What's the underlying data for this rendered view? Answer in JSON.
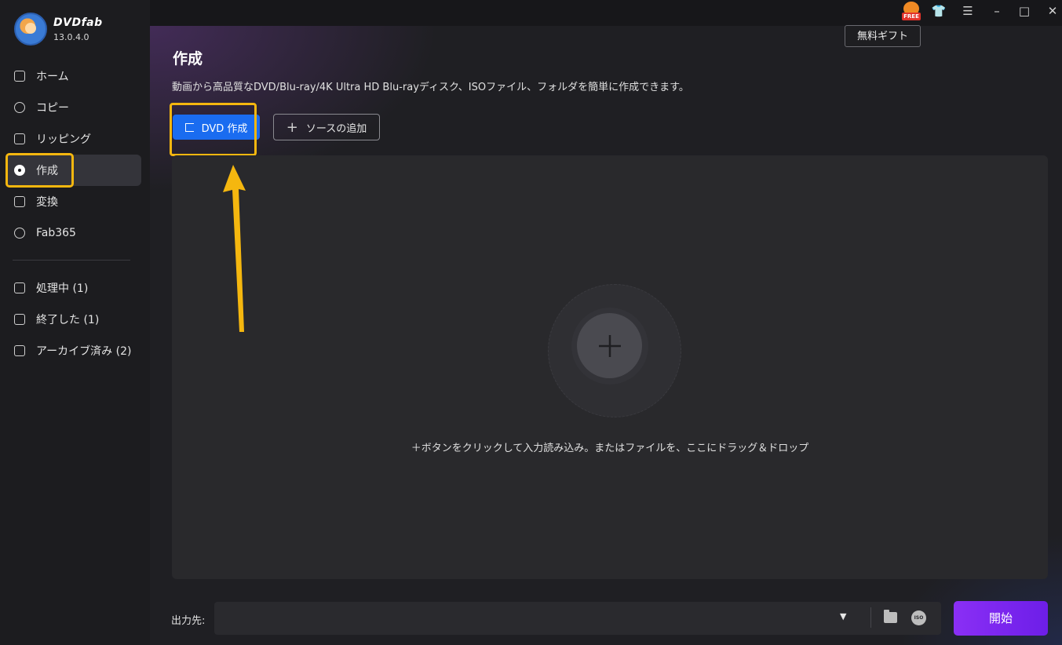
{
  "app": {
    "name": "DVDfab",
    "version": "13.0.4.0"
  },
  "sidebar": {
    "items": [
      {
        "label": "ホーム",
        "icon": "home-icon"
      },
      {
        "label": "コピー",
        "icon": "copy-icon"
      },
      {
        "label": "リッピング",
        "icon": "ripping-icon"
      },
      {
        "label": "作成",
        "icon": "disc-icon",
        "active": true
      },
      {
        "label": "変換",
        "icon": "film-icon"
      },
      {
        "label": "Fab365",
        "icon": "fab365-icon"
      }
    ],
    "queue": [
      {
        "label": "処理中 (1)",
        "icon": "processing-icon"
      },
      {
        "label": "終了した (1)",
        "icon": "finished-icon"
      },
      {
        "label": "アーカイブ済み (2)",
        "icon": "archive-icon"
      }
    ]
  },
  "titlebar": {
    "free_badge": "FREE",
    "tooltip": "無料ギフト",
    "icons": [
      "gift-icon",
      "shirt-icon",
      "menu-icon",
      "minimize-icon",
      "maximize-icon",
      "close-icon"
    ]
  },
  "main": {
    "title": "作成",
    "description": "動画から高品質なDVD/Blu-ray/4K Ultra HD Blu-rayディスク、ISOファイル、フォルダを簡単に作成できます。",
    "primary_button": "DVD 作成",
    "add_source_button": "ソースの追加",
    "drop_hint": "＋ボタンをクリックして入力読み込み。またはファイルを、ここにドラッグ＆ドロップ",
    "highlight_color": "#f5b70f"
  },
  "bottom": {
    "output_label": "出力先:",
    "output_value": "",
    "start_button": "開始",
    "iso_label": "ISO"
  }
}
